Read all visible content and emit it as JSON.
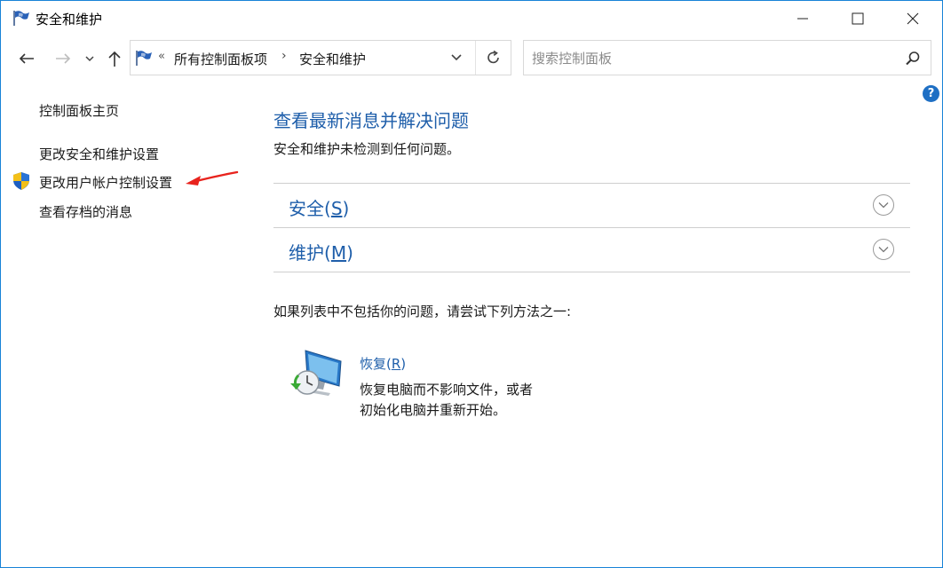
{
  "window": {
    "title": "安全和维护",
    "controls": {
      "minimize": "minimize-icon",
      "maximize": "maximize-icon",
      "close": "close-icon"
    }
  },
  "nav": {
    "address": {
      "overflow": "«",
      "segment1": "所有控制面板项",
      "separator": "›",
      "segment2": "安全和维护"
    },
    "search": {
      "placeholder": "搜索控制面板",
      "value": ""
    }
  },
  "help": {
    "label": "?"
  },
  "sidebar": {
    "home": "控制面板主页",
    "links": [
      {
        "label": "更改安全和维护设置"
      },
      {
        "label": "更改用户帐户控制设置",
        "icon": "uac-shield-icon"
      },
      {
        "label": "查看存档的消息"
      }
    ]
  },
  "main": {
    "title": "查看最新消息并解决问题",
    "status": "安全和维护未检测到任何问题。",
    "sections": [
      {
        "prefix": "安全(",
        "accel": "S",
        "suffix": ")"
      },
      {
        "prefix": "维护(",
        "accel": "M",
        "suffix": ")"
      }
    ],
    "hint": "如果列表中不包括你的问题，请尝试下列方法之一:",
    "recovery": {
      "prefix": "恢复(",
      "accel": "R",
      "suffix": ")",
      "desc_line1": "恢复电脑而不影响文件，或者",
      "desc_line2": "初始化电脑并重新开始。"
    }
  },
  "colors": {
    "accent_link": "#1e5eaa",
    "window_border": "#1883d7",
    "annotation_arrow": "#e8231d"
  }
}
